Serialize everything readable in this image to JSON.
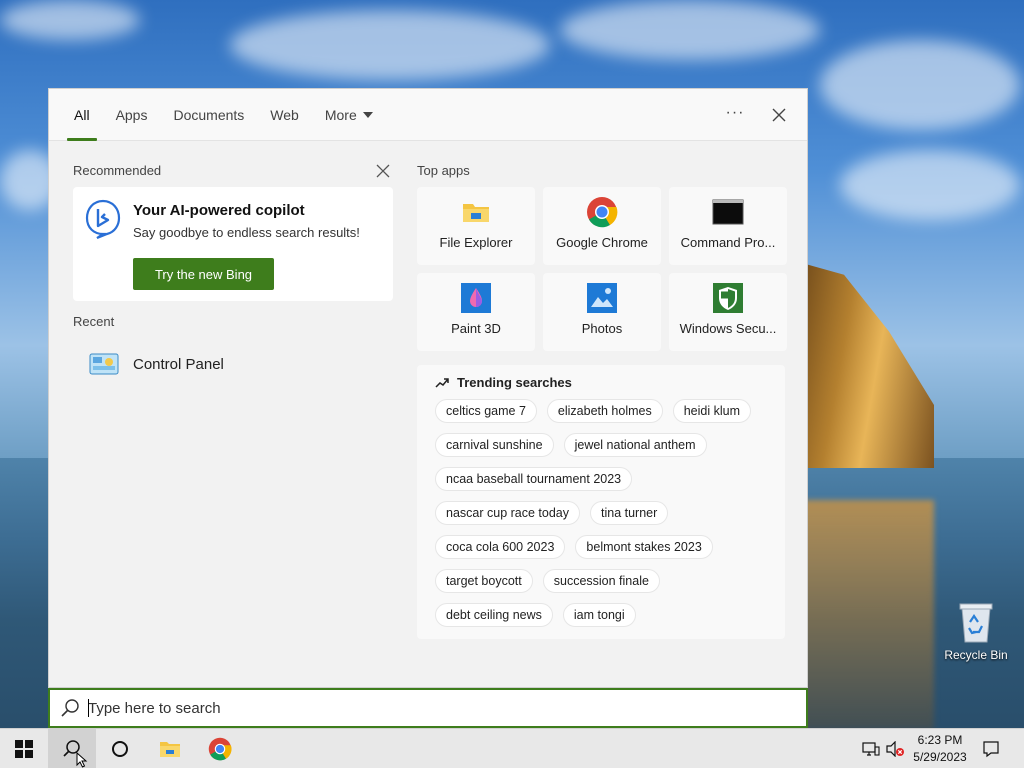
{
  "panel": {
    "tabs": [
      {
        "label": "All",
        "active": true
      },
      {
        "label": "Apps"
      },
      {
        "label": "Documents"
      },
      {
        "label": "Web"
      },
      {
        "label": "More"
      }
    ],
    "more_options": "···",
    "recommended": {
      "title": "Recommended",
      "card": {
        "title": "Your AI-powered copilot",
        "subtitle": "Say goodbye to endless search results!",
        "button": "Try the new Bing"
      }
    },
    "recent": {
      "title": "Recent",
      "items": [
        {
          "label": "Control Panel",
          "icon": "control-panel-icon"
        }
      ]
    },
    "top_apps": {
      "title": "Top apps",
      "apps": [
        {
          "label": "File Explorer",
          "icon": "file-explorer-icon"
        },
        {
          "label": "Google Chrome",
          "icon": "chrome-icon"
        },
        {
          "label": "Command Pro...",
          "icon": "command-prompt-icon"
        },
        {
          "label": "Paint 3D",
          "icon": "paint-3d-icon"
        },
        {
          "label": "Photos",
          "icon": "photos-icon"
        },
        {
          "label": "Windows Secu...",
          "icon": "windows-security-icon"
        }
      ]
    },
    "trending": {
      "title": "Trending searches",
      "rows": [
        [
          "celtics game 7",
          "elizabeth holmes",
          "heidi klum"
        ],
        [
          "carnival sunshine",
          "jewel national anthem"
        ],
        [
          "ncaa baseball tournament 2023"
        ],
        [
          "nascar cup race today",
          "tina turner"
        ],
        [
          "coca cola 600 2023",
          "belmont stakes 2023"
        ],
        [
          "target boycott",
          "succession finale"
        ],
        [
          "debt ceiling news",
          "iam tongi"
        ]
      ]
    }
  },
  "search": {
    "placeholder": "Type here to search",
    "value": ""
  },
  "desktop": {
    "recycle_bin": "Recycle Bin"
  },
  "taskbar": {
    "time": "6:23 PM",
    "date": "5/29/2023"
  },
  "colors": {
    "accent": "#3e7d1c",
    "panel_bg": "#f2f2f2"
  }
}
